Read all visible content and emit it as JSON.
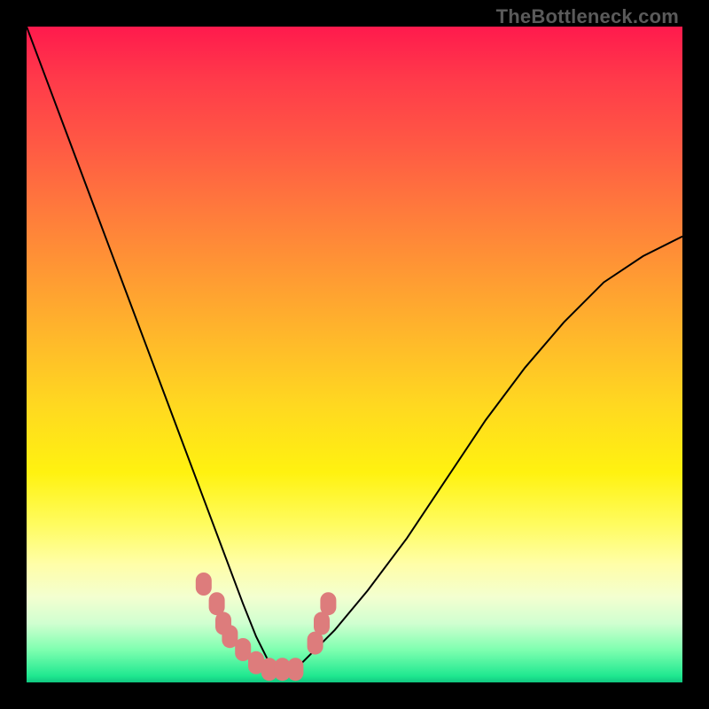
{
  "watermark": "TheBottleneck.com",
  "colors": {
    "frame_bg": "#000000",
    "gradient_top": "#ff1a4d",
    "gradient_bottom": "#10c880",
    "curve_stroke": "#000000",
    "marker_fill": "#dd7c7c"
  },
  "chart_data": {
    "type": "line",
    "title": "",
    "xlabel": "",
    "ylabel": "",
    "xlim": [
      0,
      100
    ],
    "ylim": [
      0,
      100
    ],
    "grid": false,
    "note": "Axes carry no tick labels; y encodes bottleneck severity descending to a minimum near x≈34–40, color gradient maps same quantity (red=high, green=low).",
    "series": [
      {
        "name": "left-branch",
        "x": [
          0,
          3,
          6,
          9,
          12,
          15,
          18,
          21,
          24,
          27,
          30,
          33,
          35,
          37,
          39
        ],
        "y": [
          100,
          92,
          84,
          76,
          68,
          60,
          52,
          44,
          36,
          28,
          20,
          12,
          7,
          3,
          1
        ]
      },
      {
        "name": "right-branch",
        "x": [
          40,
          43,
          47,
          52,
          58,
          64,
          70,
          76,
          82,
          88,
          94,
          100
        ],
        "y": [
          1,
          4,
          8,
          14,
          22,
          31,
          40,
          48,
          55,
          61,
          65,
          68
        ]
      }
    ],
    "markers": [
      {
        "x": 27,
        "y": 15
      },
      {
        "x": 29,
        "y": 12
      },
      {
        "x": 30,
        "y": 9
      },
      {
        "x": 31,
        "y": 7
      },
      {
        "x": 33,
        "y": 5
      },
      {
        "x": 35,
        "y": 3
      },
      {
        "x": 37,
        "y": 2
      },
      {
        "x": 39,
        "y": 2
      },
      {
        "x": 41,
        "y": 2
      },
      {
        "x": 44,
        "y": 6
      },
      {
        "x": 45,
        "y": 9
      },
      {
        "x": 46,
        "y": 12
      }
    ]
  }
}
